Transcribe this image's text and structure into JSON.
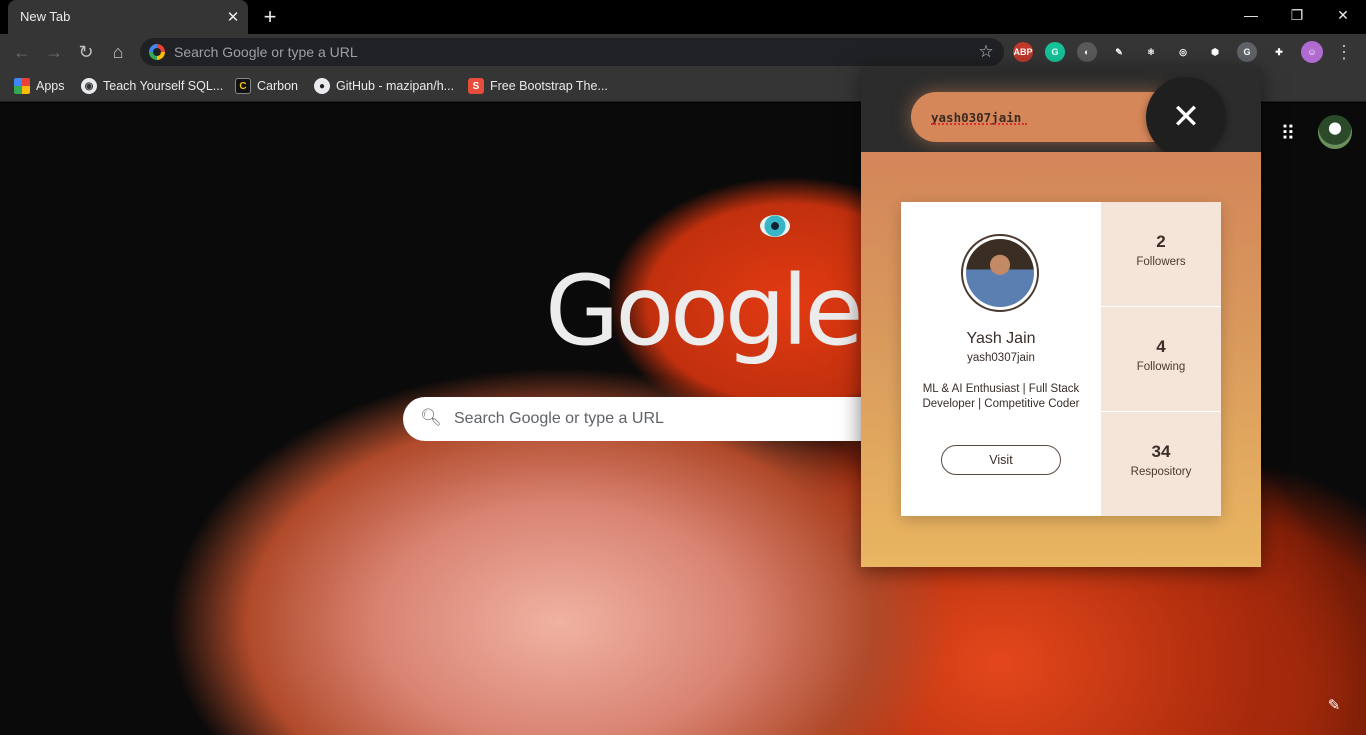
{
  "browser": {
    "tab_title": "New Tab",
    "omnibox_placeholder": "Search Google or type a URL",
    "window_controls": {
      "minimize": "—",
      "restore": "❐",
      "close": "✕"
    }
  },
  "bookmarks": [
    {
      "label": "Apps",
      "icon": "apps-grid-icon"
    },
    {
      "label": "Teach Yourself SQL...",
      "icon": "globe-icon"
    },
    {
      "label": "Carbon",
      "icon": "carbon-icon"
    },
    {
      "label": "GitHub - mazipan/h...",
      "icon": "github-icon"
    },
    {
      "label": "Free Bootstrap The...",
      "icon": "s-icon"
    }
  ],
  "extensions": [
    {
      "name": "adblock-plus-icon",
      "text": "ABP",
      "color": "#c0392b"
    },
    {
      "name": "grammarly-icon",
      "text": "G",
      "color": "#15c39a"
    },
    {
      "name": "extension-circle-icon",
      "text": "◐",
      "color": "#5a5a5a"
    },
    {
      "name": "pen-extension-icon",
      "text": "✎",
      "color": "#353535"
    },
    {
      "name": "react-devtools-icon",
      "text": "⚛",
      "color": "#353535"
    },
    {
      "name": "target-extension-icon",
      "text": "◎",
      "color": "#353535"
    },
    {
      "name": "cube-extension-icon",
      "text": "⬢",
      "color": "#353535"
    },
    {
      "name": "github-profile-extension-icon",
      "text": "G",
      "color": "#5f6368"
    },
    {
      "name": "puzzle-extensions-icon",
      "text": "✚",
      "color": "#353535"
    }
  ],
  "ntp": {
    "logo": "Google",
    "search_placeholder": "Search Google or type a URL"
  },
  "popup": {
    "username_input": "yash0307jain",
    "profile": {
      "name": "Yash Jain",
      "username": "yash0307jain",
      "bio": "ML & AI Enthusiast | Full Stack Developer | Competitive Coder",
      "visit_label": "Visit"
    },
    "stats": [
      {
        "value": "2",
        "label": "Followers"
      },
      {
        "value": "4",
        "label": "Following"
      },
      {
        "value": "34",
        "label": "Respository"
      }
    ]
  }
}
